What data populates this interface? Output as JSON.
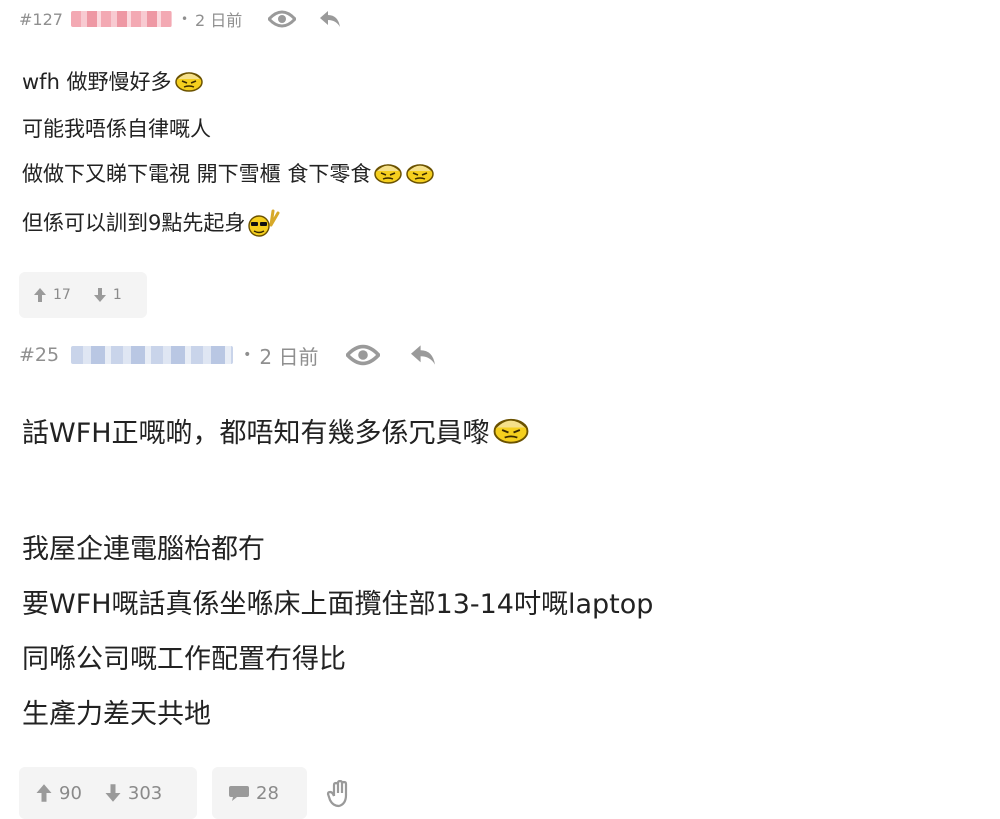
{
  "posts": [
    {
      "number": "#127",
      "time": "2 日前",
      "lines": [
        "wfh 做野慢好多",
        "可能我唔係自律嘅人",
        "做做下又睇下電視 開下雪櫃 食下零食",
        "但係可以訓到9點先起身"
      ],
      "upvotes": "17",
      "downvotes": "1"
    },
    {
      "number": "#25",
      "time": "2 日前",
      "lines": [
        "話WFH正嘅啲，都唔知有幾多係冗員嚟",
        "我屋企連電腦枱都冇",
        "要WFH嘅話真係坐喺床上面攬住部13-14吋嘅laptop",
        "同喺公司嘅工作配置冇得比",
        "生產力差天共地"
      ],
      "upvotes": "90",
      "downvotes": "303",
      "comments": "28"
    }
  ],
  "colors": {
    "meta": "#8f8f8f",
    "vote_bg": "#f4f4f4",
    "icon": "#9a9a9a"
  },
  "icons": [
    "eye-icon",
    "reply-icon",
    "thumb-up-arrow-icon",
    "thumb-down-arrow-icon",
    "comment-icon",
    "hand-icon"
  ]
}
